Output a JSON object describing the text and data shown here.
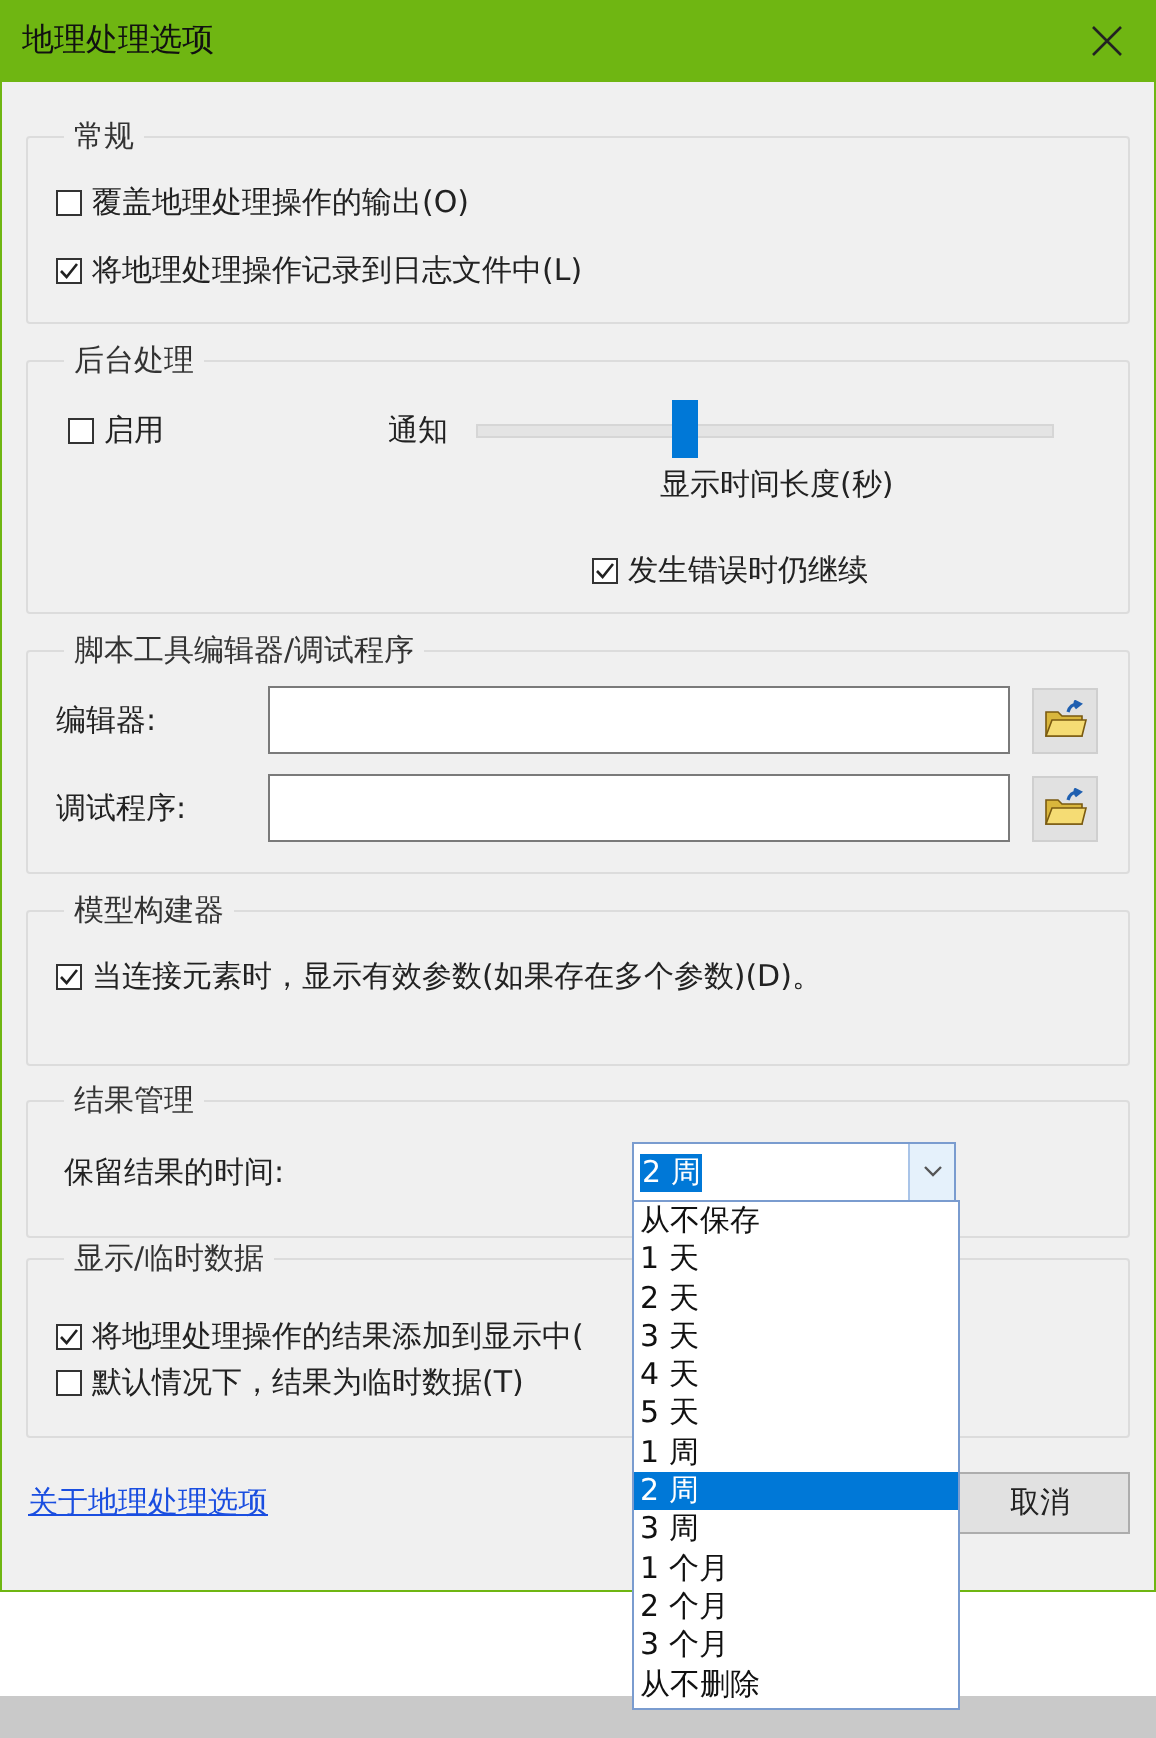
{
  "window": {
    "title": "地理处理选项"
  },
  "general": {
    "title": "常规",
    "options": [
      {
        "label": "覆盖地理处理操作的输出(O)",
        "checked": false
      },
      {
        "label": "将地理处理操作记录到日志文件中(L)",
        "checked": true
      }
    ]
  },
  "background": {
    "title": "后台处理",
    "enable": {
      "label": "启用",
      "checked": false
    },
    "slider": {
      "label": "通知",
      "level": 0.36,
      "caption": "显示时间长度(秒)"
    },
    "continue_on_error": {
      "label": "发生错误时仍继续",
      "checked": true
    }
  },
  "script_editors": {
    "title": "脚本工具编辑器/调试程序",
    "fields": [
      {
        "label": "编辑器:"
      },
      {
        "label": "调试程序:"
      }
    ]
  },
  "model_builder": {
    "title": "模型构建器",
    "options": [
      {
        "label": "当连接元素时，显示有效参数(如果存在多个参数)(D)。",
        "checked": true
      }
    ]
  },
  "results": {
    "title": "结果管理",
    "label": "保留结果的时间:",
    "combo": {
      "value": "2 周",
      "expanded": true,
      "options": [
        {
          "label": "从不保存",
          "selected": false
        },
        {
          "label": "1 天",
          "selected": false
        },
        {
          "label": "2 天",
          "selected": false
        },
        {
          "label": "3 天",
          "selected": false
        },
        {
          "label": "4 天",
          "selected": false
        },
        {
          "label": "5 天",
          "selected": false
        },
        {
          "label": "1 周",
          "selected": false
        },
        {
          "label": "2 周",
          "selected": true
        },
        {
          "label": "3 周",
          "selected": false
        },
        {
          "label": "1 个月",
          "selected": false
        },
        {
          "label": "2 个月",
          "selected": false
        },
        {
          "label": "3 个月",
          "selected": false
        },
        {
          "label": "从不删除",
          "selected": false
        }
      ]
    }
  },
  "display": {
    "title": "显示/临时数据",
    "options": [
      {
        "label": "将地理处理操作的结果添加到显示中(",
        "checked": true
      },
      {
        "label": "默认情况下，结果为临时数据(T)",
        "checked": false
      }
    ]
  },
  "footer": {
    "link": "关于地理处理选项",
    "buttons": [
      "取消"
    ]
  }
}
